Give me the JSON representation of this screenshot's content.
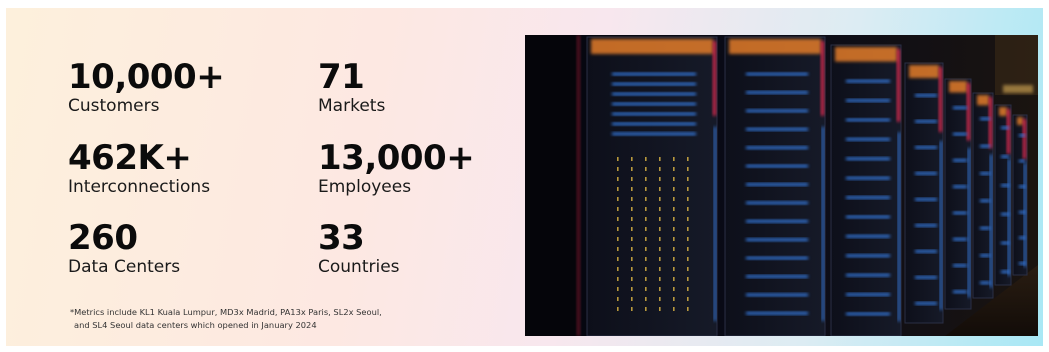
{
  "metrics": [
    {
      "value": "10,000+",
      "label": "Customers"
    },
    {
      "value": "71",
      "label": "Markets"
    },
    {
      "value": "462K+",
      "label": "Interconnections"
    },
    {
      "value": "13,000+",
      "label": "Employees"
    },
    {
      "value": "260",
      "label": "Data Centers"
    },
    {
      "value": "33",
      "label": "Countries"
    }
  ],
  "footnote": {
    "line1": "*Metrics include KL1 Kuala Lumpur, MD3x Madrid, PA13x Paris, SL2x Seoul,",
    "line2": "and SL4 Seoul data centers which opened in January 2024"
  },
  "image": {
    "subject": "server-racks-photo"
  },
  "colors": {
    "text": "#0b0b0b",
    "rack_blue": "#3b8bff",
    "rack_red": "#ff2a55",
    "rack_amber": "#ff8a2a"
  }
}
